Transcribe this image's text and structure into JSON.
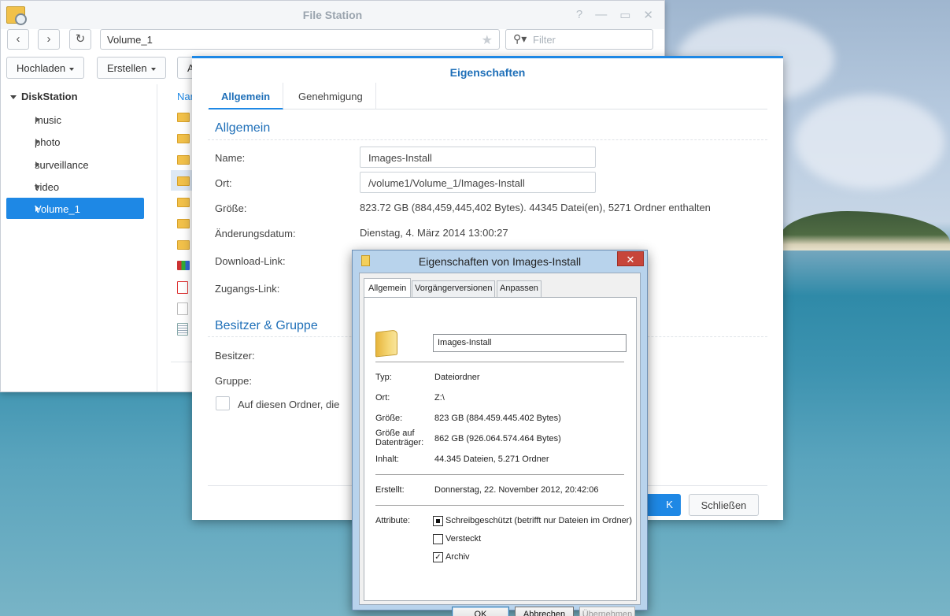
{
  "file_station": {
    "title": "File Station",
    "path": "Volume_1",
    "filter_placeholder": "Filter",
    "upload_label": "Hochladen",
    "create_label": "Erstellen",
    "action_label_partial": "A",
    "column_name_partial": "Nar",
    "tree": {
      "root": "DiskStation",
      "items": [
        "music",
        "photo",
        "surveillance",
        "video",
        "Volume_1"
      ],
      "selected": "Volume_1"
    }
  },
  "properties_dialog": {
    "title": "Eigenschaften",
    "tabs": [
      "Allgemein",
      "Genehmigung"
    ],
    "active_tab": "Allgemein",
    "section_general": "Allgemein",
    "name_label": "Name:",
    "name_value": "Images-Install",
    "location_label": "Ort:",
    "location_value": "/volume1/Volume_1/Images-Install",
    "size_label": "Größe:",
    "size_value": "823.72 GB (884,459,445,402 Bytes). 44345 Datei(en), 5271 Ordner enthalten",
    "modified_label": "Änderungsdatum:",
    "modified_value": "Dienstag, 4. März 2014 13:00:27",
    "download_link_label": "Download-Link:",
    "access_link_label": "Zugangs-Link:",
    "section_owner": "Besitzer & Gruppe",
    "owner_label": "Besitzer:",
    "group_label": "Gruppe:",
    "apply_checkbox_partial": "Auf diesen Ordner, die",
    "ok_label_partial": "K",
    "close_label": "Schließen"
  },
  "win_dialog": {
    "title": "Eigenschaften von Images-Install",
    "close_glyph": "✕",
    "tabs": [
      "Allgemein",
      "Vorgängerversionen",
      "Anpassen"
    ],
    "name": "Images-Install",
    "type_label": "Typ:",
    "type_value": "Dateiordner",
    "location_label": "Ort:",
    "location_value": "Z:\\",
    "size_label": "Größe:",
    "size_value": "823 GB (884.459.445.402 Bytes)",
    "size_on_disk_label_1": "Größe auf",
    "size_on_disk_label_2": "Datenträger:",
    "size_on_disk_value": "862 GB (926.064.574.464 Bytes)",
    "contents_label": "Inhalt:",
    "contents_value": "44.345 Dateien, 5.271 Ordner",
    "created_label": "Erstellt:",
    "created_value": "Donnerstag, 22. November 2012, 20:42:06",
    "attributes_label": "Attribute:",
    "attr_readonly": "Schreibgeschützt (betrifft nur Dateien im Ordner)",
    "attr_hidden": "Versteckt",
    "attr_archive": "Archiv",
    "attr_archive_check": "✓",
    "ok": "OK",
    "cancel": "Abbrechen",
    "apply": "Übernehmen"
  },
  "colors": {
    "accent": "#1e88e5",
    "dsm_title": "#1e6fb8",
    "win_close": "#c7453a"
  }
}
